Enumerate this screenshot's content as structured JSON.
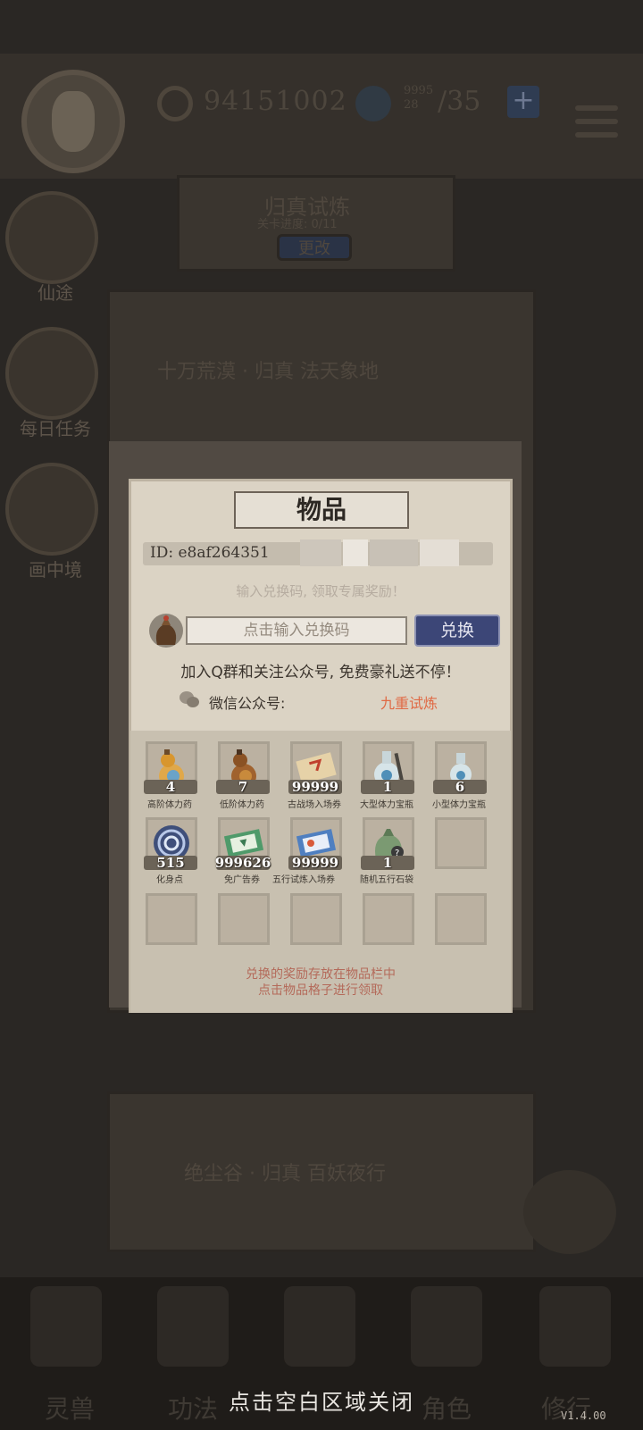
{
  "header": {
    "coins": "94151002",
    "stamina_small_top": "9995",
    "stamina_small_bottom": "28",
    "stamina": "/35",
    "plus": "+"
  },
  "sidebar": {
    "items": [
      {
        "label": "仙途"
      },
      {
        "label": "每日任务"
      },
      {
        "label": "画中境"
      }
    ]
  },
  "background": {
    "trial_title": "归真试炼",
    "trial_progress": "关卡进度: 0/11",
    "change_button": "更改",
    "stage1": "十万荒漠 · 归真 法天象地",
    "stage2": "绝尘谷 · 归真 百妖夜行"
  },
  "bottom_nav": {
    "items": [
      "灵兽",
      "功法",
      "",
      "角色",
      "修行"
    ]
  },
  "dialog": {
    "title": "物品",
    "player_id": "ID: e8af264351",
    "redeem_hint": "输入兑换码, 领取专属奖励！",
    "code_placeholder": "点击输入兑换码",
    "redeem_button": "兑换",
    "join_text": "加入Q群和关注公众号, 免费豪礼送不停！",
    "wechat_label": "微信公众号:",
    "wechat_name": "九重试炼",
    "items": [
      {
        "qty": "4",
        "name": "高阶体力药",
        "icon": "gourd-icon"
      },
      {
        "qty": "7",
        "name": "低阶体力药",
        "icon": "gourd-icon"
      },
      {
        "qty": "99999",
        "name": "古战场入场券",
        "icon": "ticket-icon"
      },
      {
        "qty": "1",
        "name": "大型体力宝瓶",
        "icon": "bottle-icon"
      },
      {
        "qty": "6",
        "name": "小型体力宝瓶",
        "icon": "bottle-icon"
      },
      {
        "qty": "515",
        "name": "化身点",
        "icon": "swirl-icon"
      },
      {
        "qty": "999626",
        "name": "免广告券",
        "icon": "coupon-icon"
      },
      {
        "qty": "99999",
        "name": "五行试炼入场券",
        "icon": "pass-icon"
      },
      {
        "qty": "1",
        "name": "随机五行石袋",
        "icon": "pouch-icon"
      }
    ],
    "footer_line1": "兑换的奖励存放在物品栏中",
    "footer_line2": "点击物品格子进行领取"
  },
  "close_hint": "点击空白区域关闭",
  "version": "V1.4.00"
}
